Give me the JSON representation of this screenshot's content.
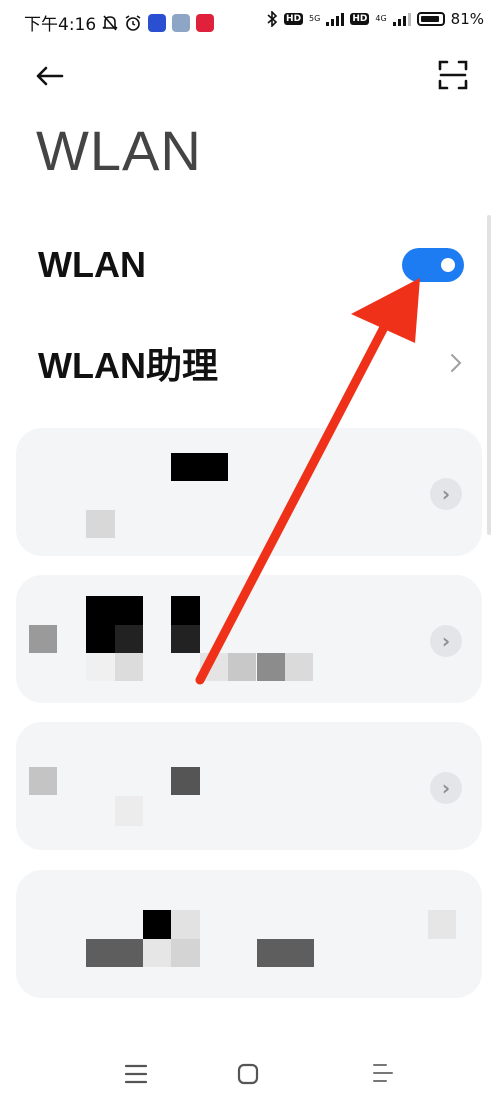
{
  "status_bar": {
    "time": "下午4:16",
    "net1": "5G",
    "net2": "4G",
    "hd": "HD",
    "battery_text": "81%",
    "battery_level": 0.81
  },
  "header": {
    "back_icon": "arrow-left-icon",
    "scan_icon": "scan-icon"
  },
  "page": {
    "title": "WLAN"
  },
  "settings": {
    "wlan_label": "WLAN",
    "wlan_enabled": true,
    "assistant_label": "WLAN助理"
  },
  "networks": {
    "item_count_visible": 4
  },
  "nav_bar": {
    "menu_icon": "menu-icon",
    "home_icon": "home-square-icon",
    "back_icon": "back-lines-icon"
  },
  "annotation": {
    "arrow_color": "#f0311a"
  },
  "colors": {
    "toggle_on": "#1d7cf2",
    "card_bg": "#f4f5f7"
  }
}
